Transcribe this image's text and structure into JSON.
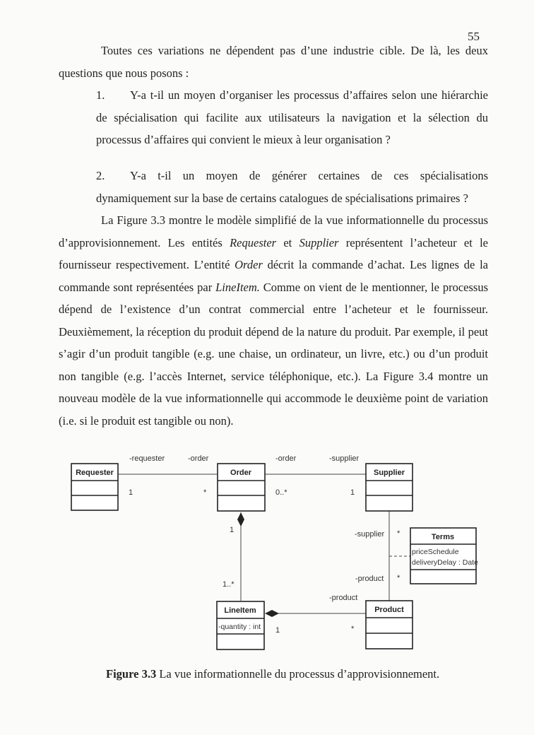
{
  "page_number": "55",
  "intro": {
    "text": "Toutes ces variations ne dépendent pas d’une industrie cible. De là, les deux questions que nous posons :"
  },
  "questions": [
    {
      "num": "1.",
      "text": "Y-a t-il un moyen d’organiser les processus d’affaires selon une hiérarchie de spécialisation qui facilite aux utilisateurs la navigation et la sélection du processus d’affaires qui convient le mieux à leur organisation ?"
    },
    {
      "num": "2.",
      "text": "Y-a t-il un moyen de générer certaines de ces spécialisations dynamiquement sur la base de certains catalogues de spécialisations primaires ?"
    }
  ],
  "paragraph": {
    "part1": "La Figure 3.3 montre le modèle simplifié de la vue informationnelle du processus d’approvisionnement. Les entités ",
    "requester": "Requester",
    "part2": " et ",
    "supplier": "Supplier",
    "part3": " représentent l’acheteur et le fournisseur respectivement. L’entité ",
    "order": "Order",
    "part4": " décrit la commande d’achat. Les lignes de la commande sont représentées par ",
    "lineitem": "LineItem.",
    "part5": "  Comme on vient de le mentionner, le processus dépend de l’existence d’un contrat commercial entre l’acheteur et le fournisseur. Deuxièmement, la réception du produit dépend de la nature du produit. Par exemple, il peut s’agir d’un produit tangible (e.g. une chaise, un ordinateur, un livre, etc.) ou d’un produit non tangible (e.g. l’accès Internet, service téléphonique, etc.). La Figure 3.4 montre un nouveau modèle de la vue informationnelle qui accommode le deuxième point de variation (i.e. si le produit est tangible ou non)."
  },
  "diagram": {
    "classes": {
      "requester": {
        "name": "Requester",
        "attributes": []
      },
      "order": {
        "name": "Order",
        "attributes": []
      },
      "supplier": {
        "name": "Supplier",
        "attributes": []
      },
      "terms": {
        "name": "Terms",
        "attributes": [
          "priceSchedule",
          "deliveryDelay : Date"
        ]
      },
      "lineitem": {
        "name": "LineItem",
        "attributes": [
          "-quantity : int"
        ]
      },
      "product": {
        "name": "Product",
        "attributes": []
      }
    },
    "labels": {
      "requester_role": "-requester",
      "requester_mult": "1",
      "order_role_left": "-order",
      "order_mult_left": "*",
      "order_role_right": "-order",
      "order_mult_right": "0..*",
      "supplier_role_top": "-supplier",
      "supplier_mult_top": "1",
      "order_comp_mult": "1",
      "lineitem_mult": "1..*",
      "supplier_role_side": "-supplier",
      "supplier_mult_side": "*",
      "product_role_side": "-product",
      "product_mult_side": "*",
      "product_role_bottom": "-product",
      "lineitem_comp_mult": "1",
      "product_mult_bottom": "*"
    }
  },
  "caption": {
    "label": "Figure 3.3",
    "text": " La vue informationnelle du processus d’approvisionnement."
  }
}
